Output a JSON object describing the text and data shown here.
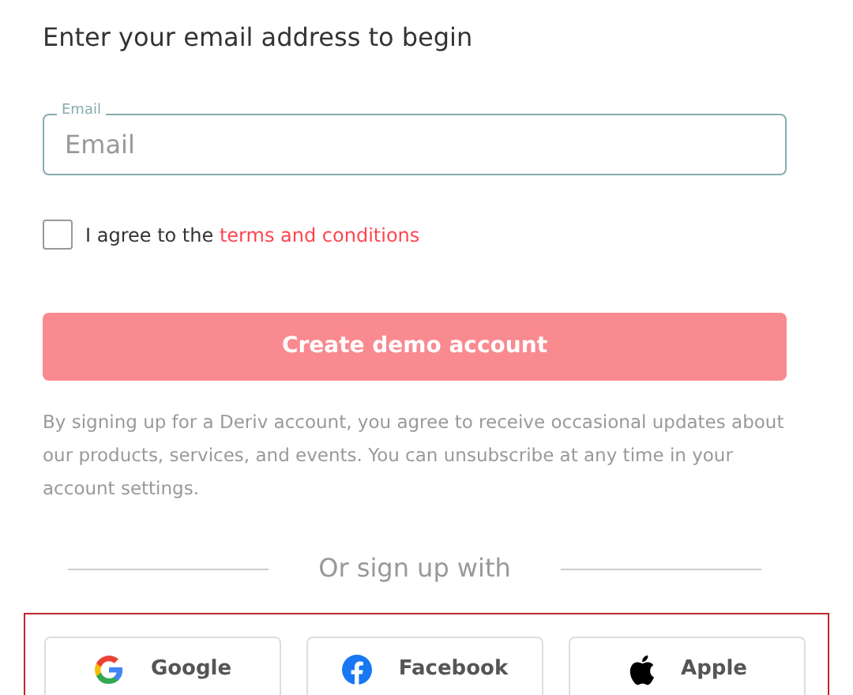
{
  "heading": "Enter your email address to begin",
  "email_field": {
    "label": "Email",
    "placeholder": "Email"
  },
  "terms": {
    "checked": false,
    "text": "I agree to the",
    "link": "terms and conditions"
  },
  "submit_button": {
    "label": "Create demo account",
    "disabled": true
  },
  "disclaimer": "By signing up for a Deriv account, you agree to receive occasional updates about our products, services, and events. You can unsubscribe at any time in your account settings.",
  "divider_label": "Or sign up with",
  "social_buttons": [
    {
      "kind": "google",
      "label": "Google"
    },
    {
      "kind": "facebook",
      "label": "Facebook"
    },
    {
      "kind": "apple",
      "label": "Apple"
    }
  ]
}
